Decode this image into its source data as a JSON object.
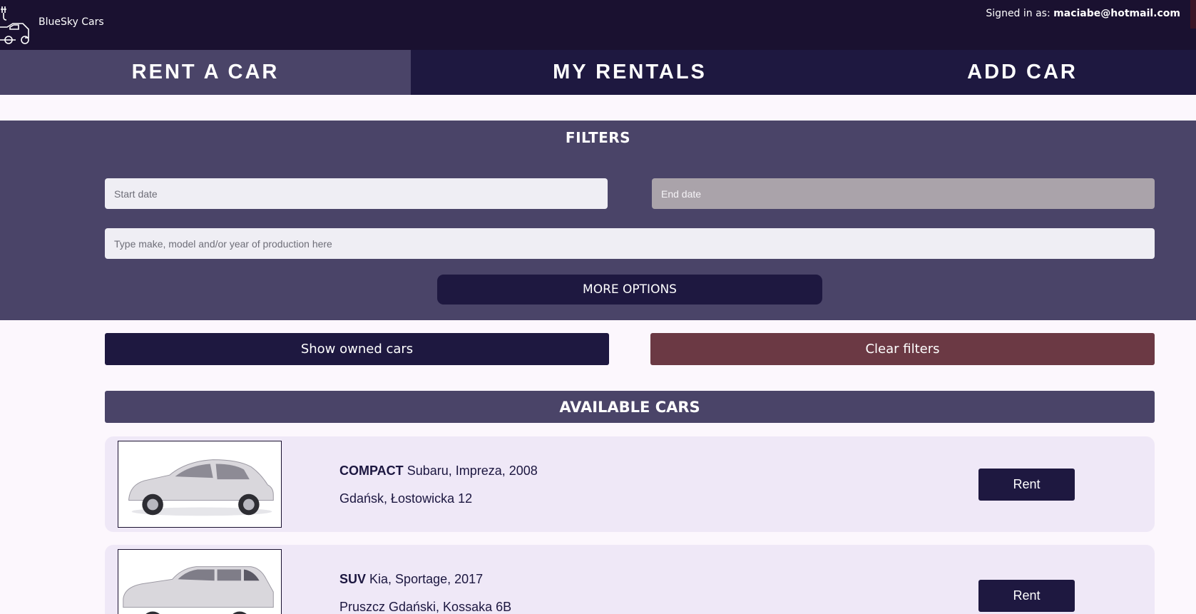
{
  "header": {
    "brand_name": "BlueSky Cars",
    "signed_in_prefix": "Signed in as:",
    "signed_in_email": "maciabe@hotmail.com"
  },
  "nav": {
    "items": [
      {
        "label": "RENT A CAR",
        "active": true
      },
      {
        "label": "MY RENTALS",
        "active": false
      },
      {
        "label": "ADD CAR",
        "active": false
      }
    ]
  },
  "filters": {
    "title": "FILTERS",
    "start_date_placeholder": "Start date",
    "end_date_placeholder": "End date",
    "search_placeholder": "Type make, model and/or year of production here",
    "more_options_label": "MORE OPTIONS"
  },
  "actions": {
    "show_owned_label": "Show owned cars",
    "clear_filters_label": "Clear filters"
  },
  "available": {
    "title": "AVAILABLE CARS",
    "cars": [
      {
        "category": "COMPACT",
        "description": "Subaru, Impreza, 2008",
        "location": "Gdańsk, Łostowicka 12",
        "rent_label": "Rent",
        "image_icon": "compact-car-photo"
      },
      {
        "category": "SUV",
        "description": "Kia, Sportage, 2017",
        "location": "Pruszcz Gdański, Kossaka 6B",
        "rent_label": "Rent",
        "image_icon": "suv-car-photo"
      }
    ]
  },
  "colors": {
    "topbar": "#1a1130",
    "nav": "#1e1840",
    "nav_active": "#4a4468",
    "filters_bg": "#4a4468",
    "clear_button": "#6b3944",
    "card_bg": "#efe8f7",
    "page_bg": "#fcf7fd"
  }
}
